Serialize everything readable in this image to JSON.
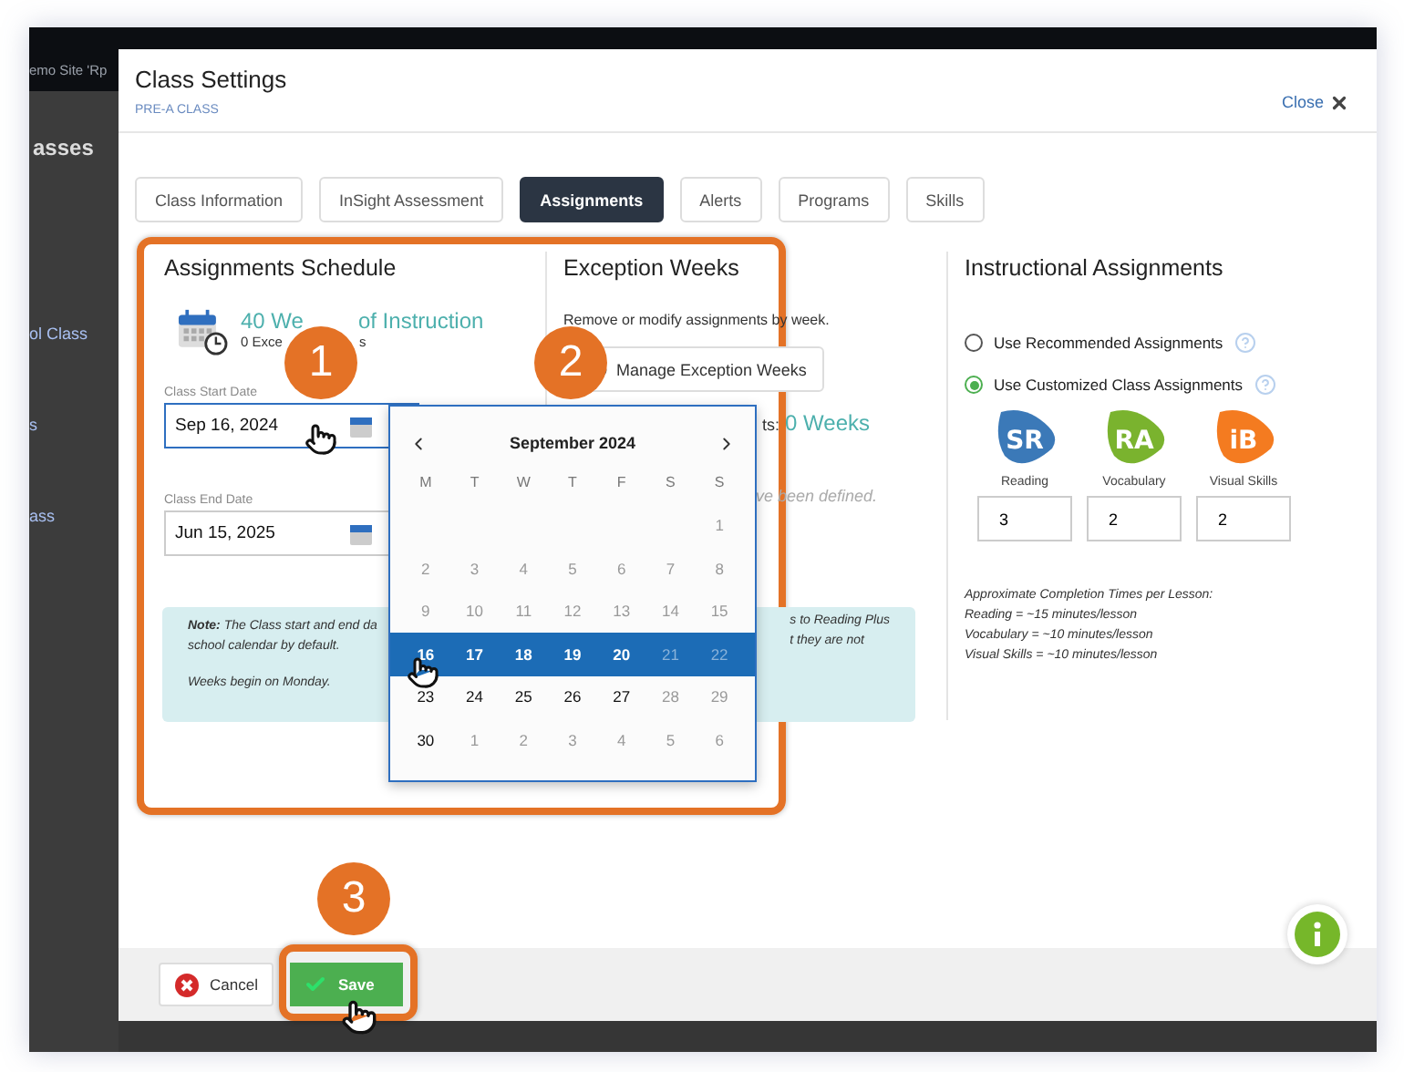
{
  "backdrop": {
    "site_title": "emo Site 'Rp",
    "sidebar_heading": "asses",
    "sidebar_links": [
      "ol Class",
      "s",
      "ass"
    ]
  },
  "dialog": {
    "title": "Class Settings",
    "subtitle": "PRE-A CLASS",
    "close": "Close"
  },
  "tabs": [
    {
      "label": "Class Information",
      "selected": false
    },
    {
      "label": "InSight Assessment",
      "selected": false
    },
    {
      "label": "Assignments",
      "selected": true
    },
    {
      "label": "Alerts",
      "selected": false
    },
    {
      "label": "Programs",
      "selected": false
    },
    {
      "label": "Skills",
      "selected": false
    }
  ],
  "schedule": {
    "heading": "Assignments Schedule",
    "weeks_parts": [
      "40 We",
      "of Instruction"
    ],
    "exceptions_parts": [
      "0 Exce",
      "s"
    ],
    "start_label": "Class Start Date",
    "start_value": "Sep 16, 2024",
    "end_label": "Class End Date",
    "end_value": "Jun 15, 2025"
  },
  "exception": {
    "heading": "Exception Weeks",
    "description": "Remove or modify assignments by week.",
    "button": "Manage Exception Weeks",
    "count_prefix": "ts:",
    "count_value": "0 Weeks",
    "empty_message": "ve been defined."
  },
  "note": {
    "left_lines": [
      "**Note:** *The Class start and end da*",
      "*school calendar by default.*",
      "*Weeks begin on Monday.*"
    ],
    "right_lines": [
      "s to Reading Plus",
      "t they are not"
    ]
  },
  "datepicker": {
    "month": "September 2024",
    "weekdays": [
      "M",
      "T",
      "W",
      "T",
      "F",
      "S",
      "S"
    ],
    "weeks": [
      {
        "selected": false,
        "days": [
          {
            "kind": "blank"
          },
          {
            "kind": "blank"
          },
          {
            "kind": "blank"
          },
          {
            "kind": "blank"
          },
          {
            "kind": "blank"
          },
          {
            "kind": "blank"
          },
          {
            "kind": "day",
            "day": "1",
            "disabled": true
          }
        ]
      },
      {
        "selected": false,
        "days": [
          {
            "kind": "day",
            "day": "2",
            "disabled": true
          },
          {
            "kind": "day",
            "day": "3",
            "disabled": true
          },
          {
            "kind": "day",
            "day": "4",
            "disabled": true
          },
          {
            "kind": "day",
            "day": "5",
            "disabled": true
          },
          {
            "kind": "day",
            "day": "6",
            "disabled": true
          },
          {
            "kind": "day",
            "day": "7",
            "disabled": true
          },
          {
            "kind": "day",
            "day": "8",
            "disabled": true
          }
        ]
      },
      {
        "selected": false,
        "days": [
          {
            "kind": "day",
            "day": "9",
            "disabled": true
          },
          {
            "kind": "day",
            "day": "10",
            "disabled": true
          },
          {
            "kind": "day",
            "day": "11",
            "disabled": true
          },
          {
            "kind": "day",
            "day": "12",
            "disabled": true
          },
          {
            "kind": "day",
            "day": "13",
            "disabled": true
          },
          {
            "kind": "day",
            "day": "14",
            "disabled": true
          },
          {
            "kind": "day",
            "day": "15",
            "disabled": true
          }
        ]
      },
      {
        "selected": true,
        "days": [
          {
            "kind": "day",
            "day": "16",
            "disabled": false
          },
          {
            "kind": "day",
            "day": "17",
            "disabled": false
          },
          {
            "kind": "day",
            "day": "18",
            "disabled": false
          },
          {
            "kind": "day",
            "day": "19",
            "disabled": false
          },
          {
            "kind": "day",
            "day": "20",
            "disabled": false
          },
          {
            "kind": "day",
            "day": "21",
            "disabled": true
          },
          {
            "kind": "day",
            "day": "22",
            "disabled": true
          }
        ]
      },
      {
        "selected": false,
        "days": [
          {
            "kind": "day",
            "day": "23",
            "disabled": false
          },
          {
            "kind": "day",
            "day": "24",
            "disabled": false
          },
          {
            "kind": "day",
            "day": "25",
            "disabled": false
          },
          {
            "kind": "day",
            "day": "26",
            "disabled": false
          },
          {
            "kind": "day",
            "day": "27",
            "disabled": false
          },
          {
            "kind": "day",
            "day": "28",
            "disabled": true
          },
          {
            "kind": "day",
            "day": "29",
            "disabled": true
          }
        ]
      },
      {
        "selected": false,
        "days": [
          {
            "kind": "day",
            "day": "30",
            "disabled": false
          },
          {
            "kind": "day",
            "day": "1",
            "disabled": true
          },
          {
            "kind": "day",
            "day": "2",
            "disabled": true
          },
          {
            "kind": "day",
            "day": "3",
            "disabled": true
          },
          {
            "kind": "day",
            "day": "4",
            "disabled": true
          },
          {
            "kind": "day",
            "day": "5",
            "disabled": true
          },
          {
            "kind": "day",
            "day": "6",
            "disabled": true
          }
        ]
      }
    ]
  },
  "instructional": {
    "heading": "Instructional Assignments",
    "options": [
      {
        "label": "Use Recommended Assignments",
        "selected": false
      },
      {
        "label": "Use Customized Class Assignments",
        "selected": true
      }
    ],
    "programs": [
      {
        "logo_text": "SR",
        "name": "Reading",
        "value": "3",
        "color": "#3b79b8"
      },
      {
        "logo_text": "RA",
        "name": "Vocabulary",
        "value": "2",
        "color": "#7ab32e"
      },
      {
        "logo_text": "iB",
        "name": "Visual Skills",
        "value": "2",
        "color": "#f47b20"
      }
    ],
    "completion_lines": [
      "Approximate Completion Times per Lesson:",
      "Reading = ~15 minutes/lesson",
      "Vocabulary = ~10 minutes/lesson",
      "Visual Skills = ~10 minutes/lesson"
    ]
  },
  "footer": {
    "cancel": "Cancel",
    "save": "Save"
  },
  "callouts": [
    "1",
    "2",
    "3"
  ]
}
